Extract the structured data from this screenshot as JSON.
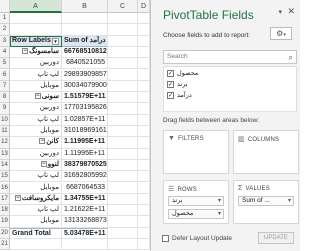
{
  "sheet": {
    "columns": [
      "A",
      "B",
      "C",
      "D"
    ],
    "header": {
      "row_labels": "Row Labels",
      "sum_label": "Sum of درآمد"
    },
    "rows": [
      {
        "row": "1",
        "label": "",
        "value": "",
        "type": "blank"
      },
      {
        "row": "2",
        "label": "",
        "value": "",
        "type": "blank"
      },
      {
        "row": "3",
        "label": "Row Labels",
        "value": "Sum of درآمد",
        "type": "header"
      },
      {
        "row": "4",
        "label": "سامسونگ",
        "value": "66768510812",
        "type": "group"
      },
      {
        "row": "5",
        "label": "دوربین",
        "value": "6840521055",
        "type": "item"
      },
      {
        "row": "6",
        "label": "لپ تاپ",
        "value": "29893909857",
        "type": "item"
      },
      {
        "row": "7",
        "label": "موبایل",
        "value": "30034079900",
        "type": "item"
      },
      {
        "row": "8",
        "label": "سونی",
        "value": "1.51579E+11",
        "type": "group"
      },
      {
        "row": "9",
        "label": "دوربین",
        "value": "17703195826",
        "type": "item"
      },
      {
        "row": "10",
        "label": "لپ تاپ",
        "value": "1.02857E+11",
        "type": "item"
      },
      {
        "row": "11",
        "label": "موبایل",
        "value": "31018969161",
        "type": "item"
      },
      {
        "row": "12",
        "label": "کانن",
        "value": "1.11995E+11",
        "type": "group"
      },
      {
        "row": "13",
        "label": "دوربین",
        "value": "1.11995E+11",
        "type": "item"
      },
      {
        "row": "14",
        "label": "لنوو",
        "value": "38379870525",
        "type": "group"
      },
      {
        "row": "15",
        "label": "لپ تاپ",
        "value": "31692805992",
        "type": "item"
      },
      {
        "row": "16",
        "label": "موبایل",
        "value": "6687064533",
        "type": "item"
      },
      {
        "row": "17",
        "label": "مایکروسافت",
        "value": "1.34755E+11",
        "type": "group"
      },
      {
        "row": "18",
        "label": "لپ تاپ",
        "value": "1.21622E+11",
        "type": "item"
      },
      {
        "row": "19",
        "label": "موبایل",
        "value": "13133268873",
        "type": "item"
      },
      {
        "row": "20",
        "label": "Grand Total",
        "value": "5.03478E+11",
        "type": "grand"
      },
      {
        "row": "21",
        "label": "",
        "value": "",
        "type": "blank"
      }
    ]
  },
  "panel": {
    "title": "PivotTable Fields",
    "subtitle": "Choose fields to add to report:",
    "search_placeholder": "Search",
    "fields": [
      {
        "label": "محصول",
        "checked": true
      },
      {
        "label": "برند",
        "checked": true
      },
      {
        "label": "درآمد",
        "checked": true
      }
    ],
    "drag_label": "Drag fields between areas below:",
    "areas": {
      "filters": {
        "title": "FILTERS"
      },
      "columns": {
        "title": "COLUMNS"
      },
      "rows": {
        "title": "ROWS",
        "items": [
          "برند",
          "محصول"
        ]
      },
      "values": {
        "title": "VALUES",
        "items": [
          "Sum of ..."
        ]
      }
    },
    "defer_label": "Defer Layout Update",
    "update_label": "UPDATE"
  }
}
